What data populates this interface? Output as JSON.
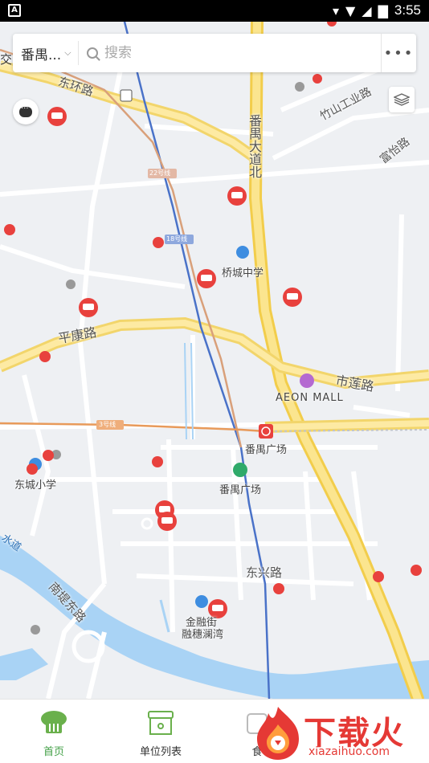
{
  "status_bar": {
    "time": "3:55",
    "left_icon": "A"
  },
  "search": {
    "city": "番禺...",
    "placeholder": "搜索",
    "more_label": "•••"
  },
  "map_labels": {
    "dongcheng_road": "东环路",
    "panyu_avenue": "番禺大道北",
    "zhushan_road": "竹山工业路",
    "fuyi_road": "富怡路",
    "pingkang_road": "平康路",
    "shilian_road": "市莲路",
    "aeon_mall": "AEON MALL",
    "qiaocheng_school": "桥城中学",
    "panyu_square_station": "番禺广场",
    "panyu_square": "番禺广场",
    "dongcheng_school": "东城小学",
    "dongxing_road": "东兴路",
    "nandi_road": "南堤东路",
    "jinrongjie": "金融街",
    "rongsui_bay": "融穗澜湾",
    "jiao": "交",
    "line22": "22号线",
    "line18": "18号线",
    "line3": "3号线",
    "water": "水道"
  },
  "bottom_nav": [
    {
      "label": "首页",
      "active": true,
      "icon": "chef-hat-icon"
    },
    {
      "label": "单位列表",
      "active": false,
      "icon": "shop-icon"
    },
    {
      "label": "食",
      "active": false,
      "icon": "food-icon"
    }
  ],
  "watermark": {
    "text": "下载火",
    "url": "xiazaihuo.com"
  },
  "colors": {
    "accent_green": "#43a047",
    "marker_red": "#e8413d",
    "road_yellow": "#f5d96b"
  }
}
